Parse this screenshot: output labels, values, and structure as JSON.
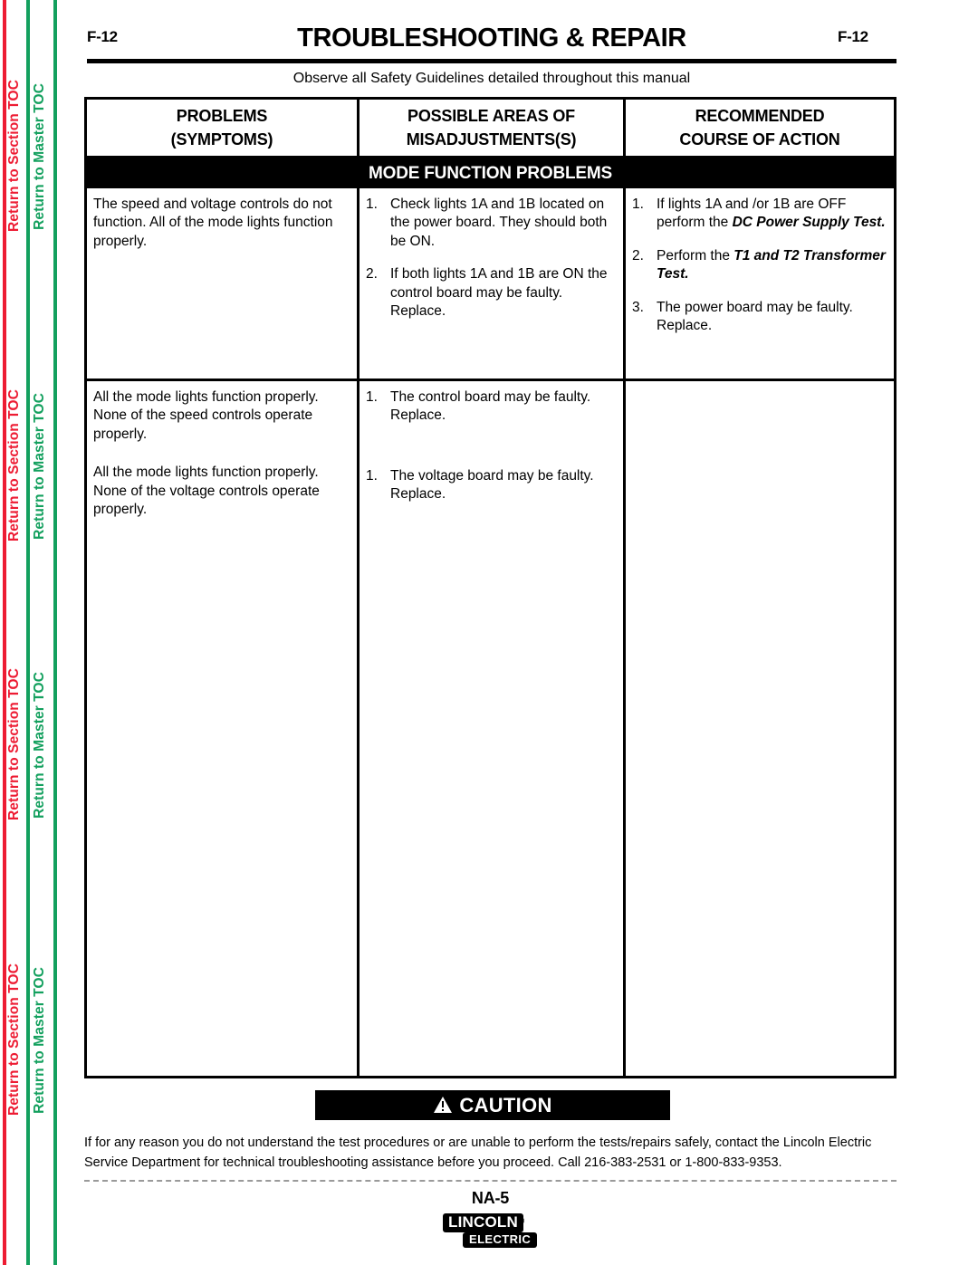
{
  "sidebar": {
    "links": [
      {
        "label": "Return to Section TOC",
        "kind": "section"
      },
      {
        "label": "Return to Master TOC",
        "kind": "master"
      },
      {
        "label": "Return to Section TOC",
        "kind": "section"
      },
      {
        "label": "Return to Master TOC",
        "kind": "master"
      },
      {
        "label": "Return to Section TOC",
        "kind": "section"
      },
      {
        "label": "Return to Master TOC",
        "kind": "master"
      },
      {
        "label": "Return to Section TOC",
        "kind": "section"
      },
      {
        "label": "Return to Master TOC",
        "kind": "master"
      }
    ],
    "section_color": "#ed1c33",
    "master_color": "#13a05e"
  },
  "header": {
    "page_number_left": "F-12",
    "page_number_right": "F-12",
    "title": "TROUBLESHOOTING & REPAIR",
    "safety_note": "Observe all Safety Guidelines detailed throughout this manual"
  },
  "table": {
    "columns": [
      {
        "line1": "PROBLEMS",
        "line2": "(SYMPTOMS)"
      },
      {
        "line1": "POSSIBLE AREAS OF",
        "line2": "MISADJUSTMENTS(S)"
      },
      {
        "line1": "RECOMMENDED",
        "line2": "COURSE OF ACTION"
      }
    ],
    "section_band": "MODE FUNCTION PROBLEMS",
    "rows": [
      {
        "symptom": "The speed and voltage controls do not function.  All of the mode lights function properly.",
        "possible_areas": [
          {
            "num": "1.",
            "text": "Check lights 1A and 1B located on the power board.  They should both be ON."
          },
          {
            "num": "2.",
            "text": "If both lights 1A and 1B are ON the control board may be faulty. Replace."
          }
        ],
        "actions": [
          {
            "num": "1.",
            "prefix": "If lights 1A and /or 1B are OFF perform the ",
            "emphasis": "DC Power Supply Test.",
            "suffix": ""
          },
          {
            "num": "2.",
            "prefix": "Perform the ",
            "emphasis": "T1 and T2 Transformer Test.",
            "suffix": ""
          },
          {
            "num": "3.",
            "prefix": "The power board may be faulty. Replace.",
            "emphasis": "",
            "suffix": ""
          }
        ]
      },
      {
        "symptom": "All the mode lights function properly. None of the speed controls operate properly.",
        "possible_areas": [
          {
            "num": "1.",
            "text": "The control board may be faulty. Replace."
          }
        ],
        "actions": []
      },
      {
        "symptom": "All the mode lights function properly. None of the voltage controls operate properly.",
        "possible_areas": [
          {
            "num": "1.",
            "text": "The voltage board may be faulty. Replace."
          }
        ],
        "actions": []
      }
    ]
  },
  "caution": {
    "banner_label": "CAUTION",
    "icon": "warning-triangle-icon",
    "body": "If for any reason you do not understand the test procedures or are unable to perform the tests/repairs safely, contact the Lincoln Electric Service Department for technical troubleshooting assistance before you proceed. Call 216-383-2531 or 1-800-833-9353."
  },
  "footer": {
    "model": "NA-5",
    "logo_top": "LINCOLN",
    "logo_registered": "®",
    "logo_bottom": "ELECTRIC"
  }
}
